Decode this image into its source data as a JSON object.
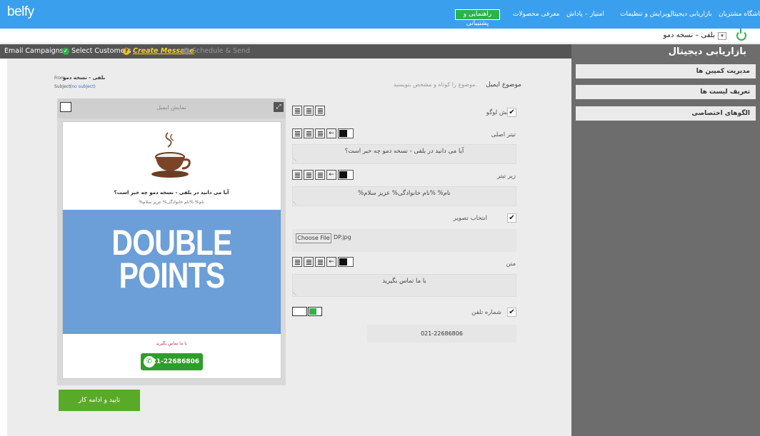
{
  "topbar": {
    "logo": "belfy",
    "nav": [
      "باشگاه مشتریان",
      "بازاریابی دیجیتال",
      "ویرایش و تنظیمات",
      "امتیاز – پاداش",
      "معرفی محصولات"
    ],
    "help": "راهنمایی و پشتیبانی",
    "accent": "#3aa0ee",
    "help_color": "#2db24a"
  },
  "account": {
    "name": "بلفی – نسخه دمو"
  },
  "steps": {
    "s1": "Email Campaigns",
    "s2": "Select Customers",
    "s3": "Create Message",
    "s4": "Schedule & Send"
  },
  "sidebar": {
    "title": "بازاریابی دیجیتال",
    "items": [
      "مدیریت کمپین ها",
      "تعریف لیست ها",
      "الگوهای اختصاصی"
    ]
  },
  "header": {
    "from_label": "From:",
    "from_value": "بلفی - نسخه دمو",
    "subject_label": "Subject:",
    "subject_value": "(no subject)"
  },
  "form": {
    "subject_label": "موضوع ایمیل",
    "subject_placeholder": "موضوع را کوتاه و مشخص بنویسید.",
    "show_logo": "نمایش لوگو",
    "main_title_label": "تیتر اصلی",
    "main_title_value": "آیا می دانید در بلفی - نسخه دمو چه خبر است؟",
    "subtitle_label": "زیر تیتر",
    "subtitle_value": "%نام% %نام خانوادگی% عزیز سلام",
    "image_label": "انتخاب تصویر",
    "file_button": "Choose File",
    "file_name": "DP.jpg",
    "text_label": "متن",
    "text_value": "با ما تماس بگیرید",
    "phone_label": "شماره تلفن",
    "phone_value": "021-22686806"
  },
  "preview": {
    "title": "نمایش ایمیل",
    "headline": "آیا می دانید در بلفی - نسخه دمو چه خبر است؟",
    "greeting": "%نام% %نام خانوادگی% عزیز سلام",
    "banner_line1": "DOUBLE",
    "banner_line2": "POINTS",
    "body_text": "با ما تماس بگیرید",
    "phone": "021-22686806",
    "banner_color": "#6c9ed8"
  },
  "submit": {
    "label": "تایید و ادامه کار"
  }
}
